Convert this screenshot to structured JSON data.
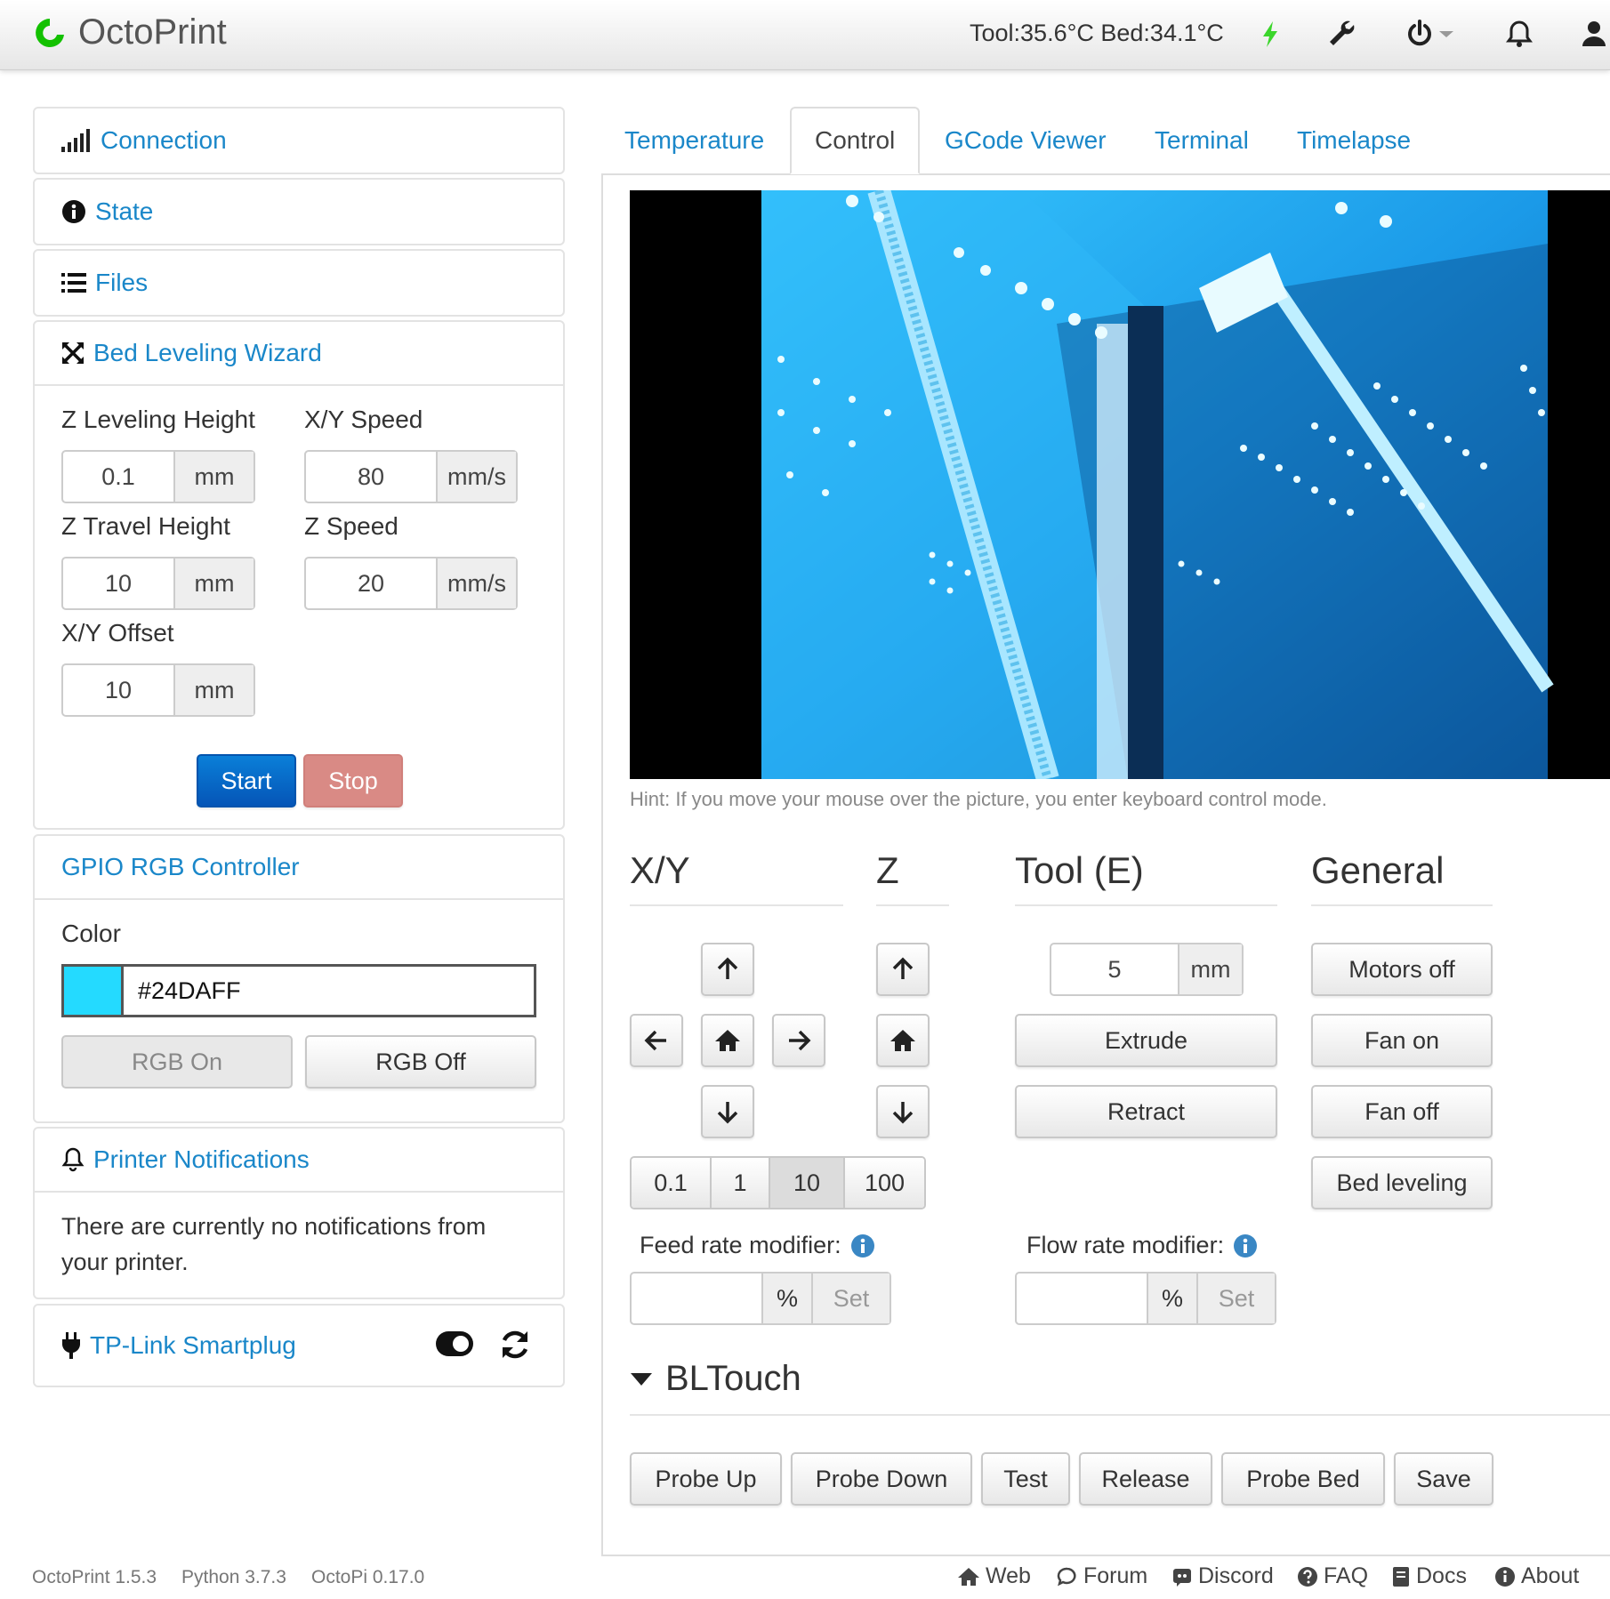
{
  "navbar": {
    "brand": "OctoPrint",
    "temps": "Tool:35.6°C Bed:34.1°C",
    "icons": [
      "lightning-icon",
      "wrench-icon",
      "power-icon",
      "bell-icon",
      "user-icon"
    ]
  },
  "sidebar": {
    "connection": "Connection",
    "state": "State",
    "files": "Files",
    "bed_leveling": {
      "title": "Bed Leveling Wizard",
      "z_leveling_height_label": "Z Leveling Height",
      "z_leveling_height": "0.1",
      "xy_speed_label": "X/Y Speed",
      "xy_speed": "80",
      "z_travel_height_label": "Z Travel Height",
      "z_travel_height": "10",
      "z_speed_label": "Z Speed",
      "z_speed": "20",
      "xy_offset_label": "X/Y Offset",
      "xy_offset": "10",
      "unit_mm": "mm",
      "unit_mms": "mm/s",
      "start": "Start",
      "stop": "Stop"
    },
    "gpio": {
      "title": "GPIO RGB Controller",
      "color_label": "Color",
      "color_value": "#24DAFF",
      "swatch": "#24DAFF",
      "rgb_on": "RGB On",
      "rgb_off": "RGB Off"
    },
    "notifications": {
      "title": "Printer Notifications",
      "body": "There are currently no notifications from your printer."
    },
    "smartplug": {
      "title": "TP-Link Smartplug"
    }
  },
  "tabs": [
    "Temperature",
    "Control",
    "GCode Viewer",
    "Terminal",
    "Timelapse"
  ],
  "control": {
    "hint": "Hint: If you move your mouse over the picture, you enter keyboard control mode.",
    "xy_title": "X/Y",
    "z_title": "Z",
    "tool_title": "Tool (E)",
    "general_title": "General",
    "steps": [
      "0.1",
      "1",
      "10",
      "100"
    ],
    "active_step": "10",
    "extrude_amount": "5",
    "extrude_unit": "mm",
    "extrude": "Extrude",
    "retract": "Retract",
    "motors_off": "Motors off",
    "fan_on": "Fan on",
    "fan_off": "Fan off",
    "bed_leveling": "Bed leveling",
    "feed_rate_label": "Feed rate modifier:",
    "flow_rate_label": "Flow rate modifier:",
    "percent": "%",
    "set": "Set"
  },
  "bltouch": {
    "title": "BLTouch",
    "buttons": [
      "Probe Up",
      "Probe Down",
      "Test",
      "Release",
      "Probe Bed",
      "Save"
    ]
  },
  "footer": {
    "versions": [
      "OctoPrint 1.5.3",
      "Python 3.7.3",
      "OctoPi 0.17.0"
    ],
    "links": [
      "Web",
      "Forum",
      "Discord",
      "FAQ",
      "Docs",
      "About"
    ]
  },
  "colors": {
    "link": "#1a87c9",
    "primary": "#0a6ac9",
    "danger": "#d98a85",
    "webcam_tint": "#1aa6ff"
  }
}
